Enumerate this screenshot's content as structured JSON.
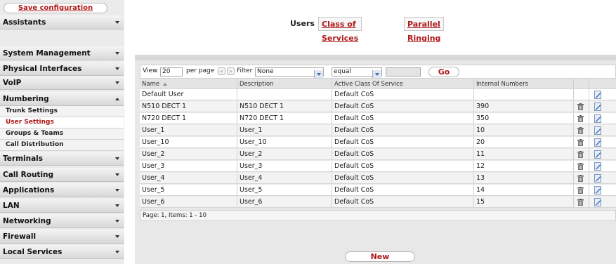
{
  "sidebar": {
    "save_label": "Save configuration",
    "items": [
      {
        "label": "Assistants",
        "state": "collapsed"
      },
      {
        "label": "System Management",
        "state": "collapsed"
      },
      {
        "label": "Physical Interfaces",
        "state": "collapsed"
      },
      {
        "label": "VoIP",
        "state": "collapsed"
      },
      {
        "label": "Numbering",
        "state": "expanded"
      },
      {
        "label": "Terminals",
        "state": "collapsed"
      },
      {
        "label": "Call Routing",
        "state": "collapsed"
      },
      {
        "label": "Applications",
        "state": "collapsed"
      },
      {
        "label": "LAN",
        "state": "collapsed"
      },
      {
        "label": "Networking",
        "state": "collapsed"
      },
      {
        "label": "Firewall",
        "state": "collapsed"
      },
      {
        "label": "Local Services",
        "state": "collapsed"
      }
    ],
    "numbering_sub": [
      {
        "label": "Trunk Settings",
        "active": false
      },
      {
        "label": "User Settings",
        "active": true
      },
      {
        "label": "Groups & Teams",
        "active": false
      },
      {
        "label": "Call Distribution",
        "active": false
      }
    ]
  },
  "tabs": [
    {
      "label": "Users",
      "active": true
    },
    {
      "label": "Class of Services",
      "active": false
    },
    {
      "label": "Parallel Ringing",
      "active": false
    }
  ],
  "filter": {
    "view_label": "View",
    "view_value": "20",
    "per_page_label": "per page",
    "prev_glyph": "«",
    "next_glyph": "»",
    "filter_in_label": "Filter in",
    "filter_field": "None",
    "filter_operator": "equal",
    "filter_value": "",
    "go_label": "Go"
  },
  "table": {
    "columns": [
      "Name",
      "Description",
      "Active Class Of Service",
      "Internal Numbers"
    ],
    "rows": [
      {
        "name": "Default User",
        "description": "",
        "cos": "Default CoS",
        "numbers": "",
        "deletable": false
      },
      {
        "name": "N510 DECT 1",
        "description": "N510 DECT 1",
        "cos": "Default CoS",
        "numbers": "390",
        "deletable": true
      },
      {
        "name": "N720 DECT 1",
        "description": "N720 DECT 1",
        "cos": "Default CoS",
        "numbers": "350",
        "deletable": true
      },
      {
        "name": "User_1",
        "description": "User_1",
        "cos": "Default CoS",
        "numbers": "10",
        "deletable": true
      },
      {
        "name": "User_10",
        "description": "User_10",
        "cos": "Default CoS",
        "numbers": "20",
        "deletable": true
      },
      {
        "name": "User_2",
        "description": "User_2",
        "cos": "Default CoS",
        "numbers": "11",
        "deletable": true
      },
      {
        "name": "User_3",
        "description": "User_3",
        "cos": "Default CoS",
        "numbers": "12",
        "deletable": true
      },
      {
        "name": "User_4",
        "description": "User_4",
        "cos": "Default CoS",
        "numbers": "13",
        "deletable": true
      },
      {
        "name": "User_5",
        "description": "User_5",
        "cos": "Default CoS",
        "numbers": "14",
        "deletable": true
      },
      {
        "name": "User_6",
        "description": "User_6",
        "cos": "Default CoS",
        "numbers": "15",
        "deletable": true
      }
    ],
    "page_info": "Page: 1, Items: 1 - 10"
  },
  "new_label": "New",
  "colors": {
    "accent": "#b01818",
    "sidebar_bg": "#ebebeb",
    "panel_bg": "#e8e8e8"
  },
  "icons": {
    "delete": "trash-icon",
    "edit": "edit-icon",
    "dropdown": "chevron-down-icon"
  }
}
